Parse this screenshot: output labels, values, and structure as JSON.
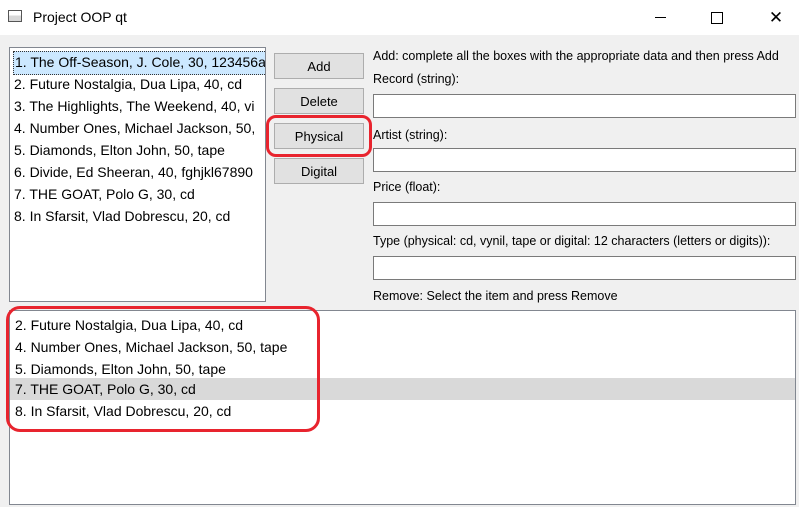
{
  "window": {
    "title": "Project OOP qt",
    "minimize_icon": "minimize-icon",
    "maximize_icon": "maximize-icon",
    "close_icon": "close-icon",
    "close_glyph": "✕"
  },
  "record_list": {
    "items": [
      {
        "text": "1. The Off-Season, J. Cole, 30, 123456a",
        "selected": true
      },
      {
        "text": "2. Future Nostalgia, Dua Lipa, 40, cd"
      },
      {
        "text": "3. The Highlights, The Weekend, 40, vi"
      },
      {
        "text": "4. Number Ones, Michael Jackson, 50,"
      },
      {
        "text": "5. Diamonds, Elton John, 50, tape"
      },
      {
        "text": "6. Divide, Ed Sheeran, 40, fghjkl67890"
      },
      {
        "text": "7. THE GOAT, Polo G, 30, cd"
      },
      {
        "text": "8. In Sfarsit, Vlad Dobrescu, 20, cd"
      }
    ],
    "scroll_left_glyph": "<",
    "scroll_right_glyph": ">"
  },
  "buttons": {
    "add": "Add",
    "delete": "Delete",
    "physical": "Physical",
    "digital": "Digital"
  },
  "form": {
    "add_instructions": "Add: complete all the boxes with the appropriate data and then press Add",
    "record_label": "Record (string):",
    "record_value": "",
    "artist_label": "Artist (string):",
    "artist_value": "",
    "price_label": "Price (float):",
    "price_value": "",
    "type_label": "Type (physical: cd, vynil, tape or digital: 12 characters (letters or digits)):",
    "type_value": "",
    "remove_instructions": "Remove: Select the item and press Remove"
  },
  "filtered_list": {
    "items": [
      {
        "text": "2. Future Nostalgia, Dua Lipa, 40, cd"
      },
      {
        "text": "4. Number Ones, Michael Jackson, 50, tape"
      },
      {
        "text": "5. Diamonds, Elton John, 50, tape"
      },
      {
        "text": "7. THE GOAT, Polo G, 30, cd",
        "highlighted": true
      },
      {
        "text": "8. In Sfarsit, Vlad Dobrescu, 20, cd"
      }
    ]
  },
  "colors": {
    "annotation": "#e8242e",
    "selection": "#cce8ff",
    "hover_row": "#d9d9d9"
  }
}
